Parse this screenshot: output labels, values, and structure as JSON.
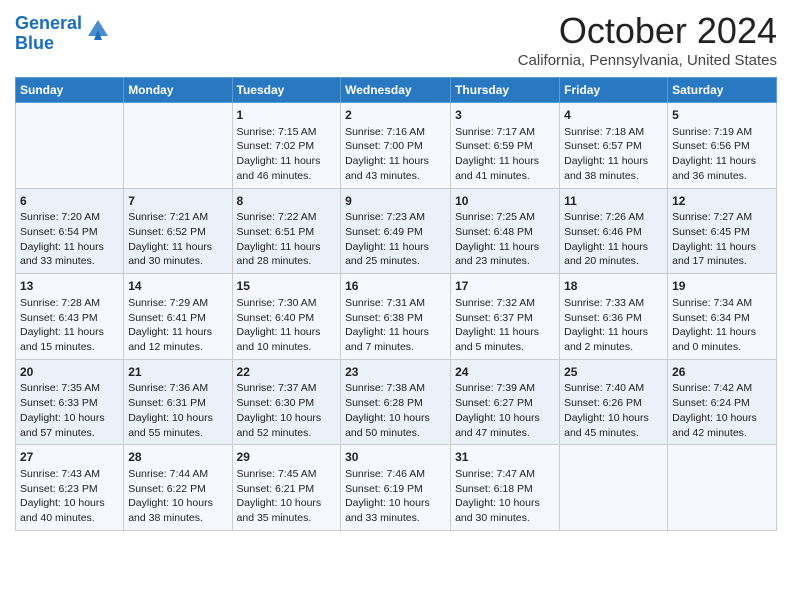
{
  "header": {
    "logo_line1": "General",
    "logo_line2": "Blue",
    "title": "October 2024",
    "subtitle": "California, Pennsylvania, United States"
  },
  "days_of_week": [
    "Sunday",
    "Monday",
    "Tuesday",
    "Wednesday",
    "Thursday",
    "Friday",
    "Saturday"
  ],
  "weeks": [
    [
      {
        "day": "",
        "sunrise": "",
        "sunset": "",
        "daylight": ""
      },
      {
        "day": "",
        "sunrise": "",
        "sunset": "",
        "daylight": ""
      },
      {
        "day": "1",
        "sunrise": "Sunrise: 7:15 AM",
        "sunset": "Sunset: 7:02 PM",
        "daylight": "Daylight: 11 hours and 46 minutes."
      },
      {
        "day": "2",
        "sunrise": "Sunrise: 7:16 AM",
        "sunset": "Sunset: 7:00 PM",
        "daylight": "Daylight: 11 hours and 43 minutes."
      },
      {
        "day": "3",
        "sunrise": "Sunrise: 7:17 AM",
        "sunset": "Sunset: 6:59 PM",
        "daylight": "Daylight: 11 hours and 41 minutes."
      },
      {
        "day": "4",
        "sunrise": "Sunrise: 7:18 AM",
        "sunset": "Sunset: 6:57 PM",
        "daylight": "Daylight: 11 hours and 38 minutes."
      },
      {
        "day": "5",
        "sunrise": "Sunrise: 7:19 AM",
        "sunset": "Sunset: 6:56 PM",
        "daylight": "Daylight: 11 hours and 36 minutes."
      }
    ],
    [
      {
        "day": "6",
        "sunrise": "Sunrise: 7:20 AM",
        "sunset": "Sunset: 6:54 PM",
        "daylight": "Daylight: 11 hours and 33 minutes."
      },
      {
        "day": "7",
        "sunrise": "Sunrise: 7:21 AM",
        "sunset": "Sunset: 6:52 PM",
        "daylight": "Daylight: 11 hours and 30 minutes."
      },
      {
        "day": "8",
        "sunrise": "Sunrise: 7:22 AM",
        "sunset": "Sunset: 6:51 PM",
        "daylight": "Daylight: 11 hours and 28 minutes."
      },
      {
        "day": "9",
        "sunrise": "Sunrise: 7:23 AM",
        "sunset": "Sunset: 6:49 PM",
        "daylight": "Daylight: 11 hours and 25 minutes."
      },
      {
        "day": "10",
        "sunrise": "Sunrise: 7:25 AM",
        "sunset": "Sunset: 6:48 PM",
        "daylight": "Daylight: 11 hours and 23 minutes."
      },
      {
        "day": "11",
        "sunrise": "Sunrise: 7:26 AM",
        "sunset": "Sunset: 6:46 PM",
        "daylight": "Daylight: 11 hours and 20 minutes."
      },
      {
        "day": "12",
        "sunrise": "Sunrise: 7:27 AM",
        "sunset": "Sunset: 6:45 PM",
        "daylight": "Daylight: 11 hours and 17 minutes."
      }
    ],
    [
      {
        "day": "13",
        "sunrise": "Sunrise: 7:28 AM",
        "sunset": "Sunset: 6:43 PM",
        "daylight": "Daylight: 11 hours and 15 minutes."
      },
      {
        "day": "14",
        "sunrise": "Sunrise: 7:29 AM",
        "sunset": "Sunset: 6:41 PM",
        "daylight": "Daylight: 11 hours and 12 minutes."
      },
      {
        "day": "15",
        "sunrise": "Sunrise: 7:30 AM",
        "sunset": "Sunset: 6:40 PM",
        "daylight": "Daylight: 11 hours and 10 minutes."
      },
      {
        "day": "16",
        "sunrise": "Sunrise: 7:31 AM",
        "sunset": "Sunset: 6:38 PM",
        "daylight": "Daylight: 11 hours and 7 minutes."
      },
      {
        "day": "17",
        "sunrise": "Sunrise: 7:32 AM",
        "sunset": "Sunset: 6:37 PM",
        "daylight": "Daylight: 11 hours and 5 minutes."
      },
      {
        "day": "18",
        "sunrise": "Sunrise: 7:33 AM",
        "sunset": "Sunset: 6:36 PM",
        "daylight": "Daylight: 11 hours and 2 minutes."
      },
      {
        "day": "19",
        "sunrise": "Sunrise: 7:34 AM",
        "sunset": "Sunset: 6:34 PM",
        "daylight": "Daylight: 11 hours and 0 minutes."
      }
    ],
    [
      {
        "day": "20",
        "sunrise": "Sunrise: 7:35 AM",
        "sunset": "Sunset: 6:33 PM",
        "daylight": "Daylight: 10 hours and 57 minutes."
      },
      {
        "day": "21",
        "sunrise": "Sunrise: 7:36 AM",
        "sunset": "Sunset: 6:31 PM",
        "daylight": "Daylight: 10 hours and 55 minutes."
      },
      {
        "day": "22",
        "sunrise": "Sunrise: 7:37 AM",
        "sunset": "Sunset: 6:30 PM",
        "daylight": "Daylight: 10 hours and 52 minutes."
      },
      {
        "day": "23",
        "sunrise": "Sunrise: 7:38 AM",
        "sunset": "Sunset: 6:28 PM",
        "daylight": "Daylight: 10 hours and 50 minutes."
      },
      {
        "day": "24",
        "sunrise": "Sunrise: 7:39 AM",
        "sunset": "Sunset: 6:27 PM",
        "daylight": "Daylight: 10 hours and 47 minutes."
      },
      {
        "day": "25",
        "sunrise": "Sunrise: 7:40 AM",
        "sunset": "Sunset: 6:26 PM",
        "daylight": "Daylight: 10 hours and 45 minutes."
      },
      {
        "day": "26",
        "sunrise": "Sunrise: 7:42 AM",
        "sunset": "Sunset: 6:24 PM",
        "daylight": "Daylight: 10 hours and 42 minutes."
      }
    ],
    [
      {
        "day": "27",
        "sunrise": "Sunrise: 7:43 AM",
        "sunset": "Sunset: 6:23 PM",
        "daylight": "Daylight: 10 hours and 40 minutes."
      },
      {
        "day": "28",
        "sunrise": "Sunrise: 7:44 AM",
        "sunset": "Sunset: 6:22 PM",
        "daylight": "Daylight: 10 hours and 38 minutes."
      },
      {
        "day": "29",
        "sunrise": "Sunrise: 7:45 AM",
        "sunset": "Sunset: 6:21 PM",
        "daylight": "Daylight: 10 hours and 35 minutes."
      },
      {
        "day": "30",
        "sunrise": "Sunrise: 7:46 AM",
        "sunset": "Sunset: 6:19 PM",
        "daylight": "Daylight: 10 hours and 33 minutes."
      },
      {
        "day": "31",
        "sunrise": "Sunrise: 7:47 AM",
        "sunset": "Sunset: 6:18 PM",
        "daylight": "Daylight: 10 hours and 30 minutes."
      },
      {
        "day": "",
        "sunrise": "",
        "sunset": "",
        "daylight": ""
      },
      {
        "day": "",
        "sunrise": "",
        "sunset": "",
        "daylight": ""
      }
    ]
  ]
}
